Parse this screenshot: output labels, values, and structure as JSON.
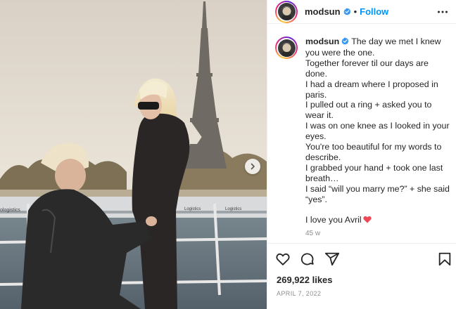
{
  "post": {
    "username": "modsun",
    "follow_label": "Follow",
    "separator": "•",
    "caption_lines": [
      "The day we met I knew you were the one.",
      "Together forever til our days are done.",
      "I had a dream where I proposed in paris.",
      "I pulled out a ring + asked you to wear it.",
      "I was on one knee as I looked in your eyes.",
      "You're too beautiful for my words to describe.",
      "I grabbed your hand + took one last breath…",
      "I said “will you marry me?” + she said “yes”."
    ],
    "closing_line": "I love you Avril",
    "time_ago": "45 w",
    "likes": "269,922 likes",
    "date": "APRIL 7, 2022"
  },
  "photo": {
    "boat_sign_left": "ologistics",
    "boat_sign_mid": "Logistics",
    "boat_sign_right": "Logistics"
  },
  "icons": {
    "verified": "verified-badge-icon",
    "more": "more-options-icon",
    "like": "heart-icon",
    "comment": "comment-icon",
    "share": "share-icon",
    "save": "bookmark-icon",
    "next": "chevron-right-icon"
  },
  "colors": {
    "link": "#0095f6",
    "verified": "#3897f0",
    "heart_emoji": "#ed4956",
    "muted": "#8e8e8e"
  }
}
